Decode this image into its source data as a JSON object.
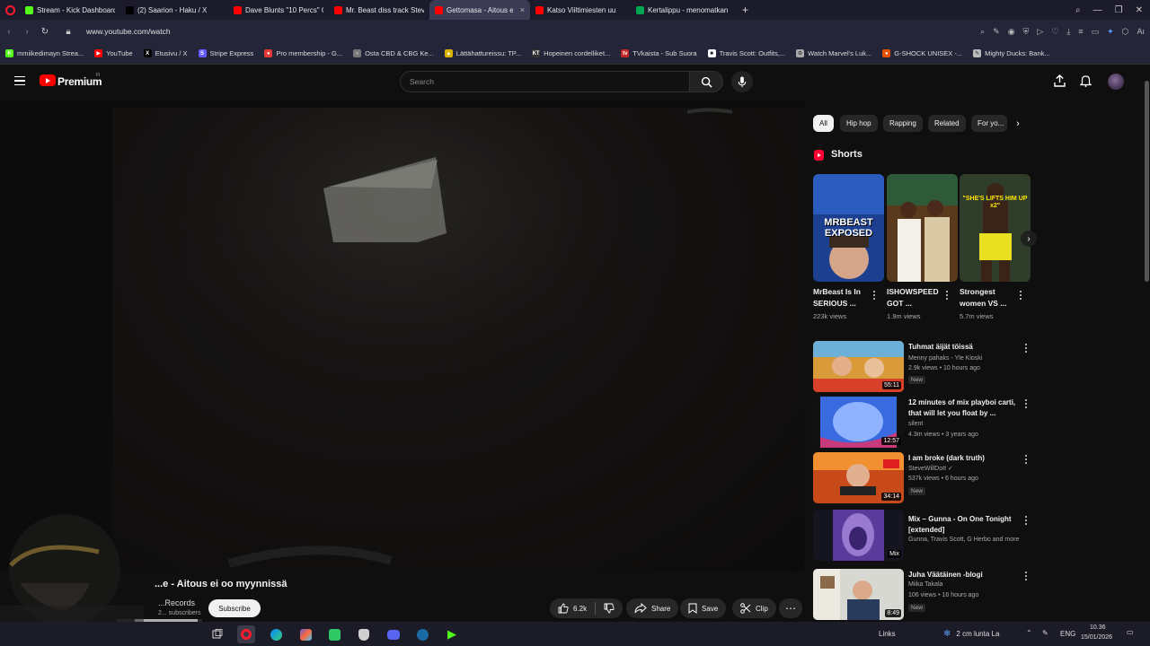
{
  "browser": {
    "tabs": [
      {
        "label": "Stream - Kick Dashboard",
        "icon": "kick-icon",
        "color": "#53fc18",
        "active": false
      },
      {
        "label": "(2) Saarion - Haku / X",
        "icon": "x-icon",
        "color": "#000000",
        "active": false
      },
      {
        "label": "Dave Blunts \"10 Percs\" C",
        "icon": "youtube-icon",
        "color": "#ff0000",
        "active": false
      },
      {
        "label": "Mr. Beast diss track Stev",
        "icon": "youtube-icon",
        "color": "#ff0000",
        "active": false
      },
      {
        "label": "Gettomasa - Aitous ei oo",
        "icon": "youtube-icon",
        "color": "#ff0000",
        "active": true
      },
      {
        "label": "Katso Viiltimiesten uu",
        "icon": "youtube-icon",
        "color": "#ff0000",
        "active": false
      },
      {
        "label": "Kertalippu - menomatkan",
        "icon": "vr-icon",
        "color": "#00a651",
        "active": false
      }
    ],
    "new_tab": "+",
    "url": "www.youtube.com/watch",
    "bookmarks": [
      {
        "label": "mmiikedimayn Strea...",
        "color": "#53fc18",
        "glyph": "K"
      },
      {
        "label": "YouTube",
        "color": "#ff0000",
        "glyph": "▶"
      },
      {
        "label": "Etusivu / X",
        "color": "#000000",
        "glyph": "X"
      },
      {
        "label": "Stripe Express",
        "color": "#635bff",
        "glyph": "S"
      },
      {
        "label": "Pro membership - G...",
        "color": "#e53935",
        "glyph": "●"
      },
      {
        "label": "Osta CBD & CBG Ke...",
        "color": "#777777",
        "glyph": "○"
      },
      {
        "label": "Lättähattureissu: TP...",
        "color": "#d9b300",
        "glyph": "▲"
      },
      {
        "label": "Hopeinen cordelliket...",
        "color": "#333333",
        "glyph": "KT"
      },
      {
        "label": "TVkaista - Sub Suora",
        "color": "#c62828",
        "glyph": "tv"
      },
      {
        "label": "Travis Scott: Outfits,...",
        "color": "#ffffff",
        "glyph": "■"
      },
      {
        "label": "Watch Marvel's Luk...",
        "color": "#aaaaaa",
        "glyph": "⚙"
      },
      {
        "label": "G-SHOCK UNISEX -...",
        "color": "#e65100",
        "glyph": "●"
      },
      {
        "label": "Mighty Ducks: Bank...",
        "color": "#bbbbbb",
        "glyph": "✎"
      }
    ]
  },
  "youtube": {
    "brand": "Premium",
    "region": "FI",
    "search_placeholder": "Search",
    "video_title": "...e - Aitous ei oo myynnissä",
    "channel": "...Records",
    "subscribers": "2... subscribers",
    "subscribe_label": "Subscribe",
    "likes": "6.2k",
    "share_label": "Share",
    "save_label": "Save",
    "clip_label": "Clip",
    "chips": [
      "All",
      "Hip hop",
      "Rapping",
      "Related",
      "For yo..."
    ],
    "shorts_heading": "Shorts",
    "shorts": [
      {
        "title": "MrBeast Is In SERIOUS ...",
        "views": "223k views",
        "overlay": "MRBEAST EXPOSED"
      },
      {
        "title": "ISHOWSPEED GOT ...",
        "views": "1.9m views",
        "overlay": ""
      },
      {
        "title": "Strongest women VS ...",
        "views": "5.7m views",
        "overlay": "\"SHE'S LIFTS HIM UP x2\""
      }
    ],
    "recommendations": [
      {
        "title": "Tuhmat äijät töissä",
        "channel": "Menny pahaks - Yle Kioski",
        "meta": "2.9k views • 10 hours ago",
        "badge": "New",
        "duration": "55:11"
      },
      {
        "title": "12 minutes of mix playboi carti, that will let you float by ...",
        "channel": "silent",
        "meta": "4.3m views • 3 years ago",
        "badge": "",
        "duration": "12:57"
      },
      {
        "title": "I am broke (dark truth)",
        "channel": "SteveWillDoIt ✓",
        "meta": "537k views • 6 hours ago",
        "badge": "New",
        "duration": "34:14"
      },
      {
        "title": "Mix – Gunna - On One Tonight [extended]",
        "channel": "Gunna, Travis Scott, G Herbo and more",
        "meta": "",
        "badge": "",
        "duration": "Mix"
      },
      {
        "title": "Juha Väätäinen -blogi",
        "channel": "Miika Takala",
        "meta": "106 views • 16 hours ago",
        "badge": "New",
        "duration": "8:49"
      }
    ]
  },
  "taskbar": {
    "links": "Links",
    "weather": "2 cm lunta La",
    "language": "ENG",
    "time": "10.36",
    "date": "15/01/2026"
  }
}
